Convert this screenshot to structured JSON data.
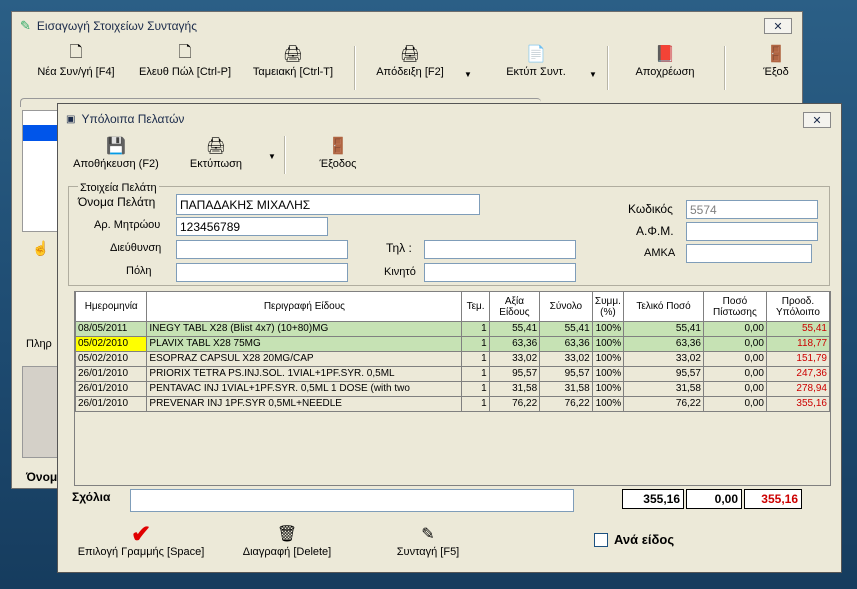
{
  "back_window": {
    "title": "Εισαγωγή Στοιχείων Συνταγής",
    "toolbar": {
      "new": "Νέα Συν/γή [F4]",
      "free_sale": "Ελευθ Πώλ [Ctrl-P]",
      "cash": "Ταμειακή [Ctrl-T]",
      "receipt": "Απόδειξη [F2]",
      "print_rx": "Εκτύπ Συντ.",
      "retire": "Αποχρέωση",
      "exit": "Έξοδ"
    },
    "partial_labels": [
      "Πληρ",
      "Όνομ"
    ]
  },
  "front_window": {
    "title": "Υπόλοιπα Πελατών",
    "toolbar": {
      "save": "Αποθήκευση (F2)",
      "print": "Εκτύπωση",
      "exit": "Έξοδος"
    },
    "customer": {
      "group_label": "Στοιχεία Πελάτη",
      "name_label": "Όνομα Πελάτη",
      "name": "ΠΑΠΑΔΑΚΗΣ ΜΙΧΑΛΗΣ",
      "reg_label": "Αρ. Μητρώου",
      "reg": "123456789",
      "address_label": "Διεύθυνση",
      "address": "",
      "phone_label": "Τηλ :",
      "phone": "",
      "city_label": "Πόλη",
      "city": "",
      "mobile_label": "Κινητό",
      "mobile": "",
      "code_label": "Κωδικός",
      "code": "5574",
      "afm_label": "Α.Φ.Μ.",
      "afm": "",
      "amka_label": "ΑΜΚΑ",
      "amka": ""
    },
    "table": {
      "headers": [
        "Ημερομηνία",
        "Περιγραφή Είδους",
        "Τεμ.",
        "Αξία Είδους",
        "Σύνολο",
        "Συμμ. (%)",
        "Τελικό Ποσό",
        "Ποσό Πίστωσης",
        "Προοδ. Υπόλοιπο"
      ],
      "rows": [
        {
          "date": "08/05/2011",
          "desc": "INEGY TABL X28 (Blist 4x7) (10+80)MG",
          "qty": "1",
          "value": "55,41",
          "total": "55,41",
          "pct": "100%",
          "final": "55,41",
          "credit": "0,00",
          "balance": "55,41"
        },
        {
          "date": "05/02/2010",
          "desc": "PLAVIX TABL X28 75MG",
          "qty": "1",
          "value": "63,36",
          "total": "63,36",
          "pct": "100%",
          "final": "63,36",
          "credit": "0,00",
          "balance": "118,77"
        },
        {
          "date": "05/02/2010",
          "desc": "ESOPRAZ CAPSUL X28 20MG/CAP",
          "qty": "1",
          "value": "33,02",
          "total": "33,02",
          "pct": "100%",
          "final": "33,02",
          "credit": "0,00",
          "balance": "151,79"
        },
        {
          "date": "26/01/2010",
          "desc": "PRIORIX TETRA PS.INJ.SOL. 1VIAL+1PF.SYR. 0,5ML",
          "qty": "1",
          "value": "95,57",
          "total": "95,57",
          "pct": "100%",
          "final": "95,57",
          "credit": "0,00",
          "balance": "247,36"
        },
        {
          "date": "26/01/2010",
          "desc": "PENTAVAC INJ 1VIAL+1PF.SYR. 0,5ML 1 DOSE  (with two",
          "qty": "1",
          "value": "31,58",
          "total": "31,58",
          "pct": "100%",
          "final": "31,58",
          "credit": "0,00",
          "balance": "278,94"
        },
        {
          "date": "26/01/2010",
          "desc": "PREVENAR INJ 1PF.SYR 0,5ML+NEEDLE",
          "qty": "1",
          "value": "76,22",
          "total": "76,22",
          "pct": "100%",
          "final": "76,22",
          "credit": "0,00",
          "balance": "355,16"
        }
      ]
    },
    "notes_label": "Σχόλια",
    "notes": "",
    "totals": {
      "final": "355,16",
      "credit": "0,00",
      "balance": "355,16"
    },
    "bottom": {
      "select_line": "Επιλογή Γραμμής [Space]",
      "delete": "Διαγραφή [Delete]",
      "prescription": "Συνταγή [F5]",
      "per_item": "Ανά είδος"
    },
    "colors": {
      "selected_row": "#c6e2b4",
      "highlight": "#ffff00",
      "balance_red": "#cc0000"
    }
  }
}
